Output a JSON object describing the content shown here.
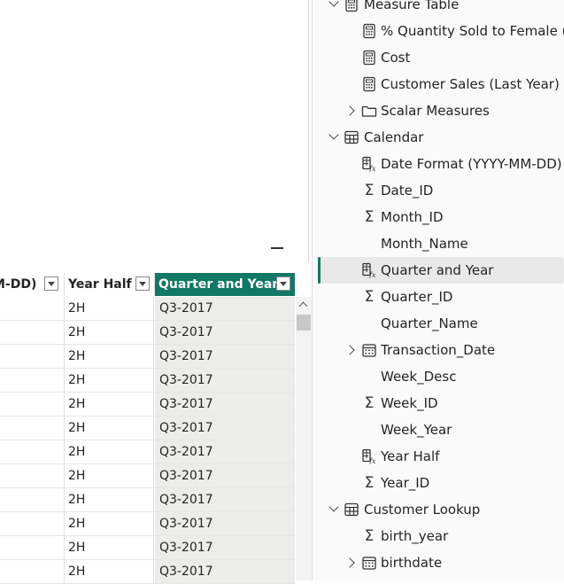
{
  "table": {
    "columns": [
      {
        "label": "M-DD)"
      },
      {
        "label": "Year Half"
      },
      {
        "label": "Quarter and Year"
      }
    ],
    "rows": [
      {
        "year_half": "2H",
        "quarter": "Q3-2017"
      },
      {
        "year_half": "2H",
        "quarter": "Q3-2017"
      },
      {
        "year_half": "2H",
        "quarter": "Q3-2017"
      },
      {
        "year_half": "2H",
        "quarter": "Q3-2017"
      },
      {
        "year_half": "2H",
        "quarter": "Q3-2017"
      },
      {
        "year_half": "2H",
        "quarter": "Q3-2017"
      },
      {
        "year_half": "2H",
        "quarter": "Q3-2017"
      },
      {
        "year_half": "2H",
        "quarter": "Q3-2017"
      },
      {
        "year_half": "2H",
        "quarter": "Q3-2017"
      },
      {
        "year_half": "2H",
        "quarter": "Q3-2017"
      },
      {
        "year_half": "2H",
        "quarter": "Q3-2017"
      },
      {
        "year_half": "2H",
        "quarter": "Q3-2017"
      }
    ]
  },
  "fields": {
    "items": [
      {
        "label": "Measure Table",
        "icon": "table-calculator-icon",
        "level": 0,
        "chevron": "down"
      },
      {
        "label": "% Quantity Sold to Female (V...",
        "icon": "calculator-icon",
        "level": 1,
        "chevron": ""
      },
      {
        "label": "Cost",
        "icon": "calculator-icon",
        "level": 1,
        "chevron": ""
      },
      {
        "label": "Customer Sales (Last Year)",
        "icon": "calculator-icon",
        "level": 1,
        "chevron": ""
      },
      {
        "label": "Scalar Measures",
        "icon": "folder-icon",
        "level": 1,
        "chevron": "right"
      },
      {
        "label": "Calendar",
        "icon": "table-icon",
        "level": 0,
        "chevron": "down"
      },
      {
        "label": "Date Format (YYYY-MM-DD)",
        "icon": "calculated-column-icon",
        "level": 1,
        "chevron": ""
      },
      {
        "label": "Date_ID",
        "icon": "sigma-icon",
        "level": 1,
        "chevron": ""
      },
      {
        "label": "Month_ID",
        "icon": "sigma-icon",
        "level": 1,
        "chevron": ""
      },
      {
        "label": "Month_Name",
        "icon": "",
        "level": 1,
        "chevron": ""
      },
      {
        "label": "Quarter and Year",
        "icon": "calculated-column-icon",
        "level": 1,
        "chevron": "",
        "selected": true
      },
      {
        "label": "Quarter_ID",
        "icon": "sigma-icon",
        "level": 1,
        "chevron": ""
      },
      {
        "label": "Quarter_Name",
        "icon": "",
        "level": 1,
        "chevron": ""
      },
      {
        "label": "Transaction_Date",
        "icon": "calendar-icon",
        "level": 1,
        "chevron": "right"
      },
      {
        "label": "Week_Desc",
        "icon": "",
        "level": 1,
        "chevron": ""
      },
      {
        "label": "Week_ID",
        "icon": "sigma-icon",
        "level": 1,
        "chevron": ""
      },
      {
        "label": "Week_Year",
        "icon": "",
        "level": 1,
        "chevron": ""
      },
      {
        "label": "Year Half",
        "icon": "calculated-column-icon",
        "level": 1,
        "chevron": ""
      },
      {
        "label": "Year_ID",
        "icon": "sigma-icon",
        "level": 1,
        "chevron": ""
      },
      {
        "label": "Customer Lookup",
        "icon": "table-icon",
        "level": 0,
        "chevron": "down"
      },
      {
        "label": "birth_year",
        "icon": "sigma-icon",
        "level": 1,
        "chevron": ""
      },
      {
        "label": "birthdate",
        "icon": "calendar-icon",
        "level": 1,
        "chevron": "right"
      }
    ]
  },
  "colors": {
    "accent": "#117865",
    "selected_bg": "#e9e9e9",
    "pane_bg": "#fafafa",
    "cell_selected_bg": "#ececeb"
  }
}
